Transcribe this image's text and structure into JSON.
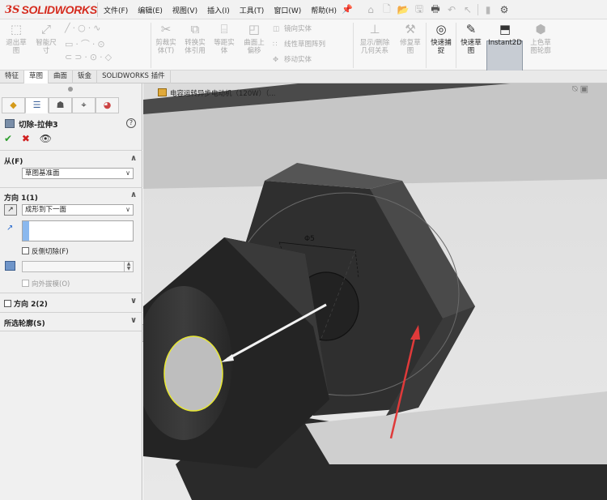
{
  "app": {
    "logo_ds": "3S",
    "logo_name": "SOLIDWORKS",
    "brand_color": "#d52b1e"
  },
  "menu": [
    "文件(F)",
    "编辑(E)",
    "视图(V)",
    "插入(I)",
    "工具(T)",
    "窗口(W)",
    "帮助(H)"
  ],
  "quick_access_icons": [
    "home-icon",
    "new-file-icon",
    "open-file-icon",
    "save-icon",
    "print-icon",
    "undo-icon",
    "select-icon",
    "rebuild-icon",
    "options-gear-icon"
  ],
  "ribbon": {
    "exit_sketch": "退出草\n图",
    "smart_dimension": "智能尺\n寸",
    "trim_entities": "剪裁实\n体(T)",
    "convert_entities": "转换实\n体引用",
    "offset_entities": "等距实\n体",
    "surface_offset": "曲面上\n偏移",
    "mirror_entities": "镜向实体",
    "linear_pattern": "线性草图阵列",
    "move_entities": "移动实体",
    "display_delete_relations": "显示/删除\n几何关系",
    "repair_sketch": "修复草\n图",
    "quick_snaps": "快速捕\n捉",
    "rapid_sketch": "快速草\n图",
    "instant2d": "Instant2D",
    "shaded_sketch": "上色草\n图轮廓"
  },
  "tabs": [
    "特征",
    "草图",
    "曲面",
    "钣金",
    "SOLIDWORKS 插件"
  ],
  "active_tab": 1,
  "property_manager": {
    "tab_icons": [
      "feature-manager-icon",
      "property-manager-icon",
      "configuration-manager-icon",
      "dimxpert-icon",
      "display-manager-icon"
    ],
    "title": "切除-拉伸3",
    "from_section": {
      "label": "从(F)",
      "value": "草图基准面"
    },
    "direction1": {
      "label": "方向 1(1)",
      "end_condition": "成形到下一面",
      "flip_side_label": "反侧切除(F)",
      "draft_outward_label": "向外拔模(O)"
    },
    "direction2": {
      "label": "方向 2(2)"
    },
    "selected_contours": {
      "label": "所选轮廓(S)"
    }
  },
  "viewport": {
    "document_title": "电容运转异步电动机（120W）（...",
    "dimension_text": "Φ5",
    "arrow_color": "#e03a3a",
    "highlight_color": "#e8e832"
  }
}
